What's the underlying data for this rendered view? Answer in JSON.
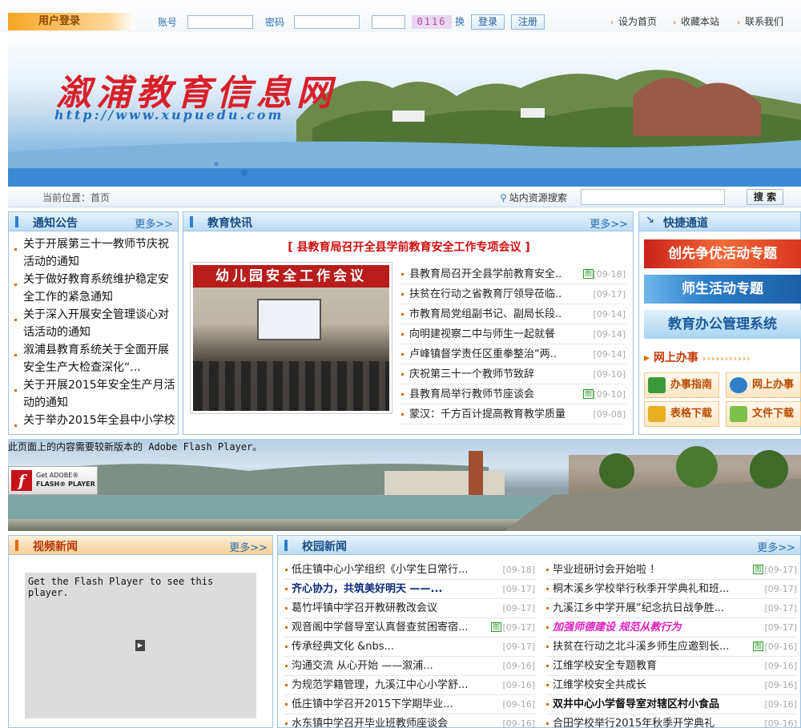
{
  "topbar": {
    "login_title": "用户登录",
    "account_label": "账号",
    "password_label": "密码",
    "captcha": "0116",
    "captcha_refresh": "换",
    "login_button": "登录",
    "register_button": "注册",
    "links": [
      "设为首页",
      "收藏本站",
      "联系我们"
    ]
  },
  "banner": {
    "title": "溆浦教育信息网",
    "url": "http://www.xupuedu.com"
  },
  "location": {
    "breadcrumb": "当前位置：首页",
    "search_label": "站内资源搜索",
    "search_value": "",
    "search_button": "搜 索"
  },
  "notice": {
    "title": "通知公告",
    "more": "更多>>",
    "items": [
      "关于开展第三十一教师节庆祝活动的通知",
      "关于做好教育系统维护稳定安全工作的紧急通知",
      "关于深入开展安全管理谈心对话活动的通知",
      "溆浦县教育系统关于全面开展安全生产大检查深化“...",
      "关于开展2015年安全生产月活动的通知",
      "关于举办2015年全县中小学校"
    ]
  },
  "edu_news": {
    "title": "教育快讯",
    "more": "更多>>",
    "headline": "[ 县教育局召开全县学前教育安全工作专项会议 ]",
    "photo_caption": "幼儿园安全工作会议",
    "items": [
      {
        "text": "县教育局召开全县学前教育安全..",
        "date": "[09-18]",
        "img": true
      },
      {
        "text": "扶贫在行动之省教育厅领导莅临..",
        "date": "[09-17]",
        "img": false
      },
      {
        "text": "市教育局党组副书记、副局长段..",
        "date": "[09-14]",
        "img": false
      },
      {
        "text": "向明建视察二中与师生一起就餐",
        "date": "[09-14]",
        "img": false
      },
      {
        "text": "卢峰镇督学责任区重拳整治“两..",
        "date": "[09-14]",
        "img": false
      },
      {
        "text": "庆祝第三十一个教师节致辞",
        "date": "[09-10]",
        "img": false
      },
      {
        "text": "县教育局举行教师节座谈会",
        "date": "[09-10]",
        "img": true
      },
      {
        "text": "蒙汉：千方百计提高教育教学质量",
        "date": "[09-08]",
        "img": false
      }
    ],
    "img_mark": "图"
  },
  "quick": {
    "title": "快捷通道",
    "banners": [
      "创先争优活动专题",
      "师生活动专题",
      "教育办公管理系统"
    ],
    "online_title": "网上办事",
    "buttons": [
      "办事指南",
      "网上办事",
      "表格下载",
      "文件下载"
    ],
    "colors": {
      "banner1": "#e8442a",
      "banner2": "#2d7fc8",
      "banner3": "#4fa0d6"
    }
  },
  "flash": {
    "message": "此页面上的内容需要较新版本的 Adobe Flash Player。",
    "badge_line1": "Get ADOBE®",
    "badge_line2": "FLASH® PLAYER",
    "video_msg": "Get the Flash Player to see this player."
  },
  "video_news": {
    "title": "视频新闻",
    "more": "更多>>"
  },
  "campus_news": {
    "title": "校园新闻",
    "more": "更多>>",
    "left": [
      {
        "text": "低庄镇中心小学组织《小学生日常行...",
        "date": "[09-18]",
        "img": false,
        "style": ""
      },
      {
        "text": "齐心协力，共筑美好明天 ——...",
        "date": "[09-17]",
        "img": false,
        "style": "bold-blue"
      },
      {
        "text": "葛竹坪镇中学召开教研教改会议",
        "date": "[09-17]",
        "img": false,
        "style": ""
      },
      {
        "text": "观音阁中学督导室认真督查贫困寄宿...",
        "date": "[09-17]",
        "img": true,
        "style": ""
      },
      {
        "text": "传承经典文化 &nbs...",
        "date": "[09-17]",
        "img": false,
        "style": ""
      },
      {
        "text": "沟通交流 从心开始 ——溆浦...",
        "date": "[09-16]",
        "img": false,
        "style": ""
      },
      {
        "text": "为规范学籍管理，九溪江中心小学舒...",
        "date": "[09-16]",
        "img": false,
        "style": ""
      },
      {
        "text": "低庄镇中学召开2015下学期毕业...",
        "date": "[09-16]",
        "img": false,
        "style": ""
      },
      {
        "text": "水东镇中学召开毕业班教师座谈会",
        "date": "[09-16]",
        "img": false,
        "style": ""
      }
    ],
    "right": [
      {
        "text": "毕业班研讨会开始啦 ！",
        "date": "[09-17]",
        "img": true,
        "style": ""
      },
      {
        "text": "桐木溪乡学校举行秋季开学典礼和班...",
        "date": "[09-17]",
        "img": false,
        "style": ""
      },
      {
        "text": "九溪江乡中学开展“纪念抗日战争胜...",
        "date": "[09-17]",
        "img": false,
        "style": ""
      },
      {
        "text": "加强师德建设 规范从教行为",
        "date": "[09-17]",
        "img": false,
        "style": "pink-italic"
      },
      {
        "text": "扶贫在行动之北斗溪乡师生应邀到长...",
        "date": "[09-16]",
        "img": true,
        "style": ""
      },
      {
        "text": "江维学校安全专题教育",
        "date": "[09-16]",
        "img": false,
        "style": ""
      },
      {
        "text": "江维学校安全共成长",
        "date": "[09-16]",
        "img": false,
        "style": ""
      },
      {
        "text": "双井中心小学督导室对辖区村小食品",
        "date": "[09-16]",
        "img": false,
        "style": "bold-black"
      },
      {
        "text": "合田学校举行2015年秋季开学典礼",
        "date": "[09-16]",
        "img": false,
        "style": ""
      }
    ]
  }
}
